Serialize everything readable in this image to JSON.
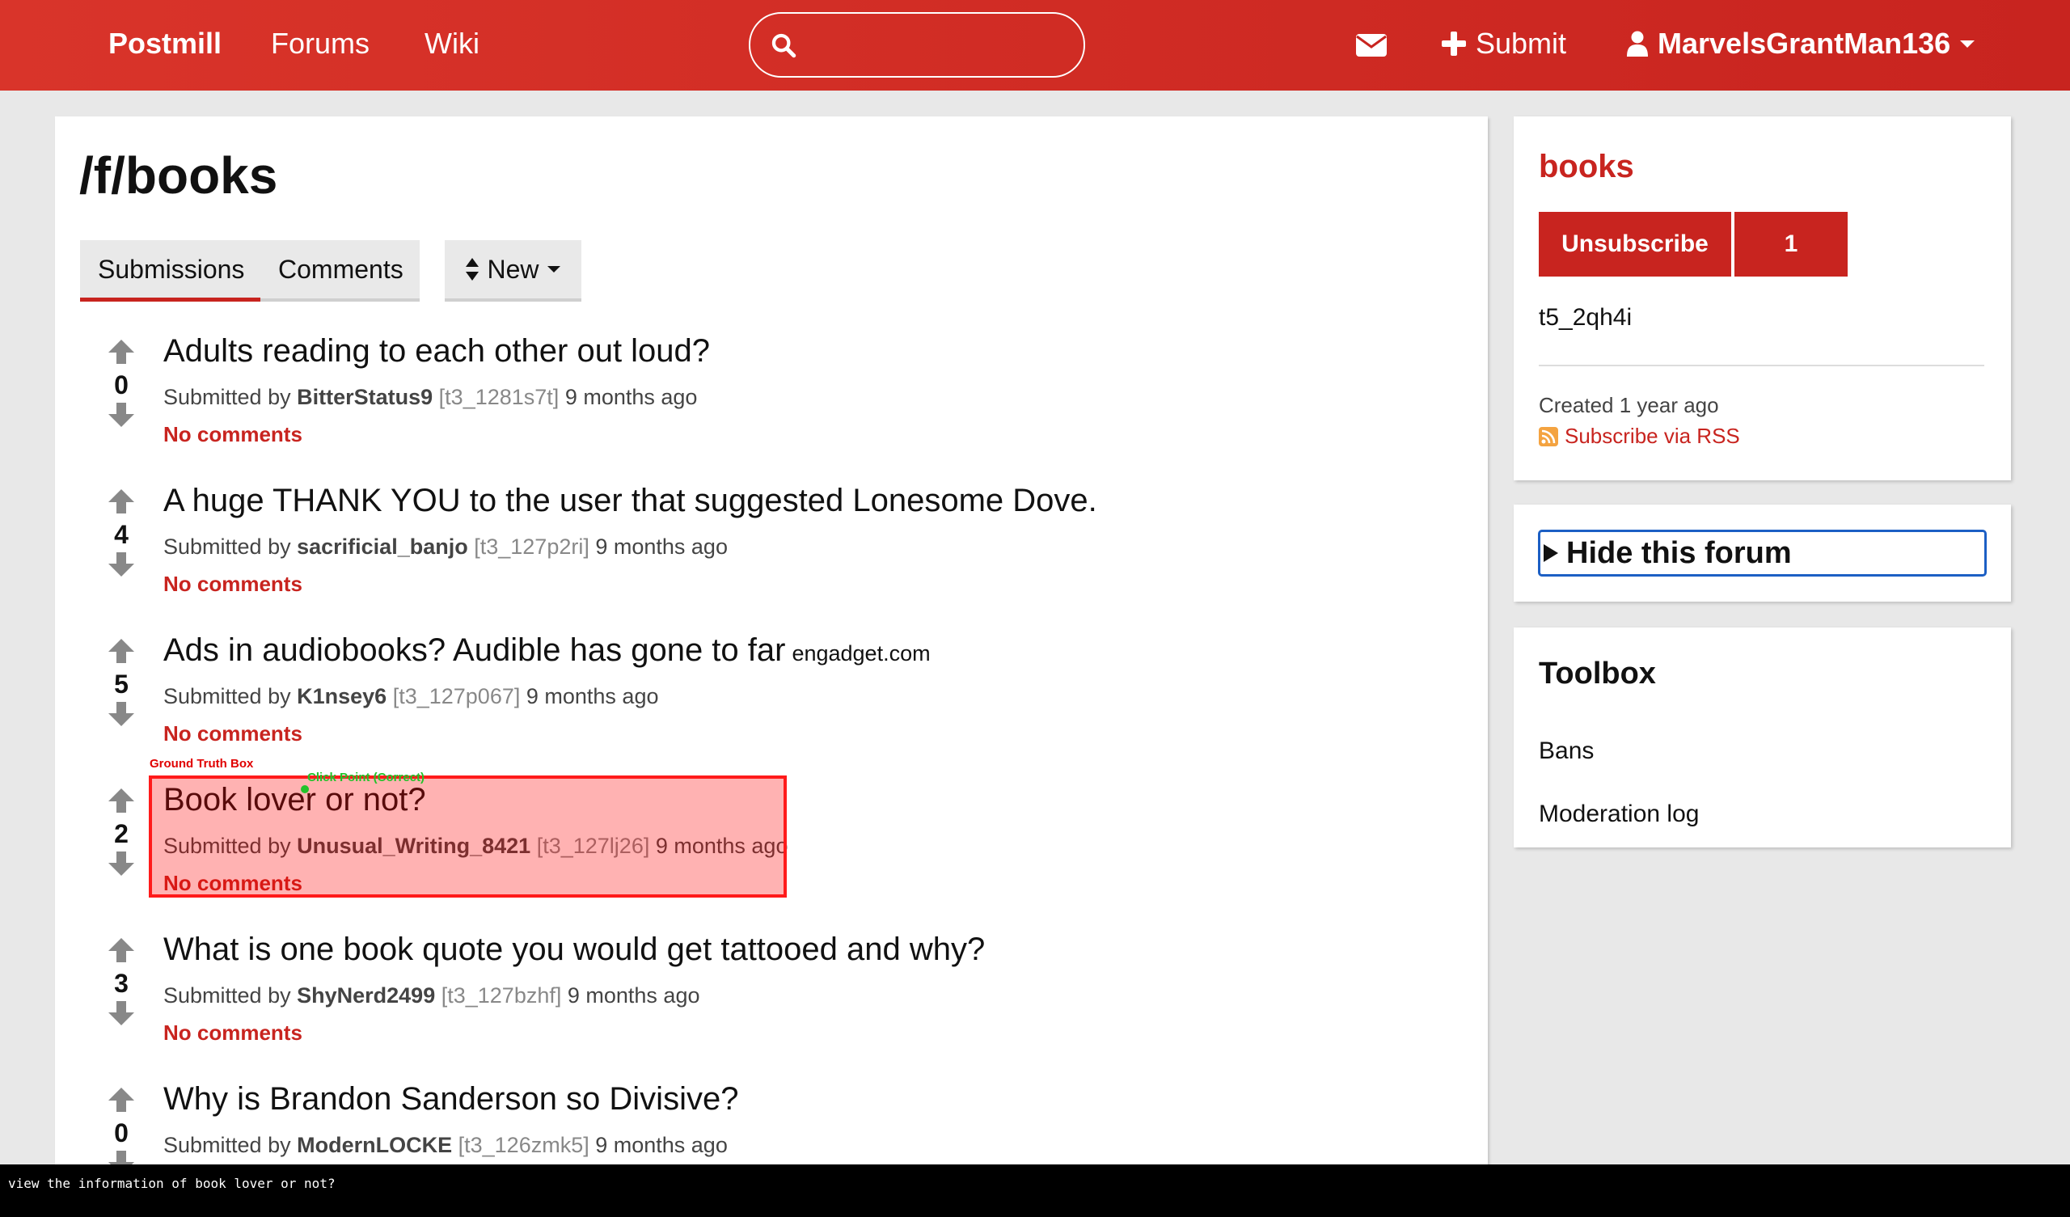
{
  "nav": {
    "brand": "Postmill",
    "forums": "Forums",
    "wiki": "Wiki",
    "search_placeholder": "",
    "submit": "Submit",
    "username": "MarvelsGrantMan136"
  },
  "page": {
    "title": "/f/books",
    "tabs": [
      "Submissions",
      "Comments"
    ],
    "sort": "New"
  },
  "submissions": [
    {
      "score": "0",
      "title": "Adults reading to each other out loud?",
      "domain": "",
      "submitted_by": "Submitted by",
      "author": "BitterStatus9",
      "id": "[t3_1281s7t]",
      "time": "9 months ago",
      "comments": "No comments"
    },
    {
      "score": "4",
      "title": "A huge THANK YOU to the user that suggested Lonesome Dove.",
      "domain": "",
      "submitted_by": "Submitted by",
      "author": "sacrificial_banjo",
      "id": "[t3_127p2ri]",
      "time": "9 months ago",
      "comments": "No comments"
    },
    {
      "score": "5",
      "title": "Ads in audiobooks? Audible has gone to far",
      "domain": "engadget.com",
      "submitted_by": "Submitted by",
      "author": "K1nsey6",
      "id": "[t3_127p067]",
      "time": "9 months ago",
      "comments": "No comments"
    },
    {
      "score": "2",
      "title": "Book lover or not?",
      "domain": "",
      "submitted_by": "Submitted by",
      "author": "Unusual_Writing_8421",
      "id": "[t3_127lj26]",
      "time": "9 months ago",
      "comments": "No comments"
    },
    {
      "score": "3",
      "title": "What is one book quote you would get tattooed and why?",
      "domain": "",
      "submitted_by": "Submitted by",
      "author": "ShyNerd2499",
      "id": "[t3_127bzhf]",
      "time": "9 months ago",
      "comments": "No comments"
    },
    {
      "score": "0",
      "title": "Why is Brandon Sanderson so Divisive?",
      "domain": "",
      "submitted_by": "Submitted by",
      "author": "ModernLOCKE",
      "id": "[t3_126zmk5]",
      "time": "9 months ago",
      "comments": ""
    }
  ],
  "sidebar": {
    "forum_name": "books",
    "unsubscribe": "Unsubscribe",
    "subscriber_count": "1",
    "forum_id": "t5_2qh4i",
    "created": "Created 1 year ago",
    "rss": "Subscribe via RSS",
    "hide_forum": "Hide this forum",
    "toolbox_title": "Toolbox",
    "toolbox_items": [
      "Bans",
      "Moderation log"
    ]
  },
  "annotation": {
    "gt_label": "Ground Truth Box",
    "click_label": "Click Point (Correct)"
  },
  "instruction": "view the information of book lover or not?",
  "colors": {
    "accent": "#c8241f",
    "navbar": "#d32f25",
    "focus": "#1c5fc4"
  }
}
